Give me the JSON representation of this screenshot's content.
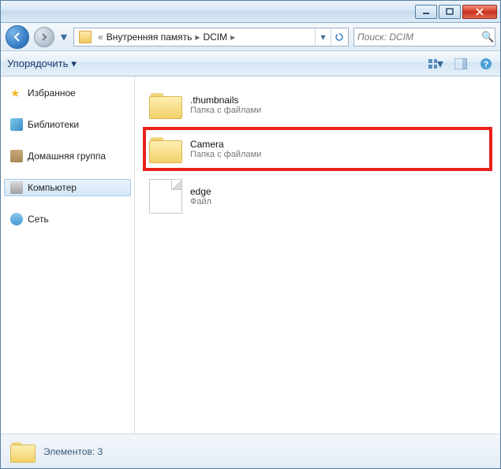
{
  "breadcrumbs": {
    "seg1": "Внутренняя память",
    "seg2": "DCIM",
    "prefix": "«"
  },
  "search": {
    "placeholder": "Поиск: DCIM"
  },
  "toolbar": {
    "organize": "Упорядочить"
  },
  "sidebar": {
    "favorites": "Избранное",
    "libraries": "Библиотеки",
    "homegroup": "Домашняя группа",
    "computer": "Компьютер",
    "network": "Сеть"
  },
  "items": [
    {
      "name": ".thumbnails",
      "type": "Папка с файлами",
      "kind": "folder",
      "highlight": false
    },
    {
      "name": "Camera",
      "type": "Папка с файлами",
      "kind": "folder",
      "highlight": true
    },
    {
      "name": "edge",
      "type": "Файл",
      "kind": "file",
      "highlight": false
    }
  ],
  "status": {
    "text": "Элементов: 3"
  }
}
